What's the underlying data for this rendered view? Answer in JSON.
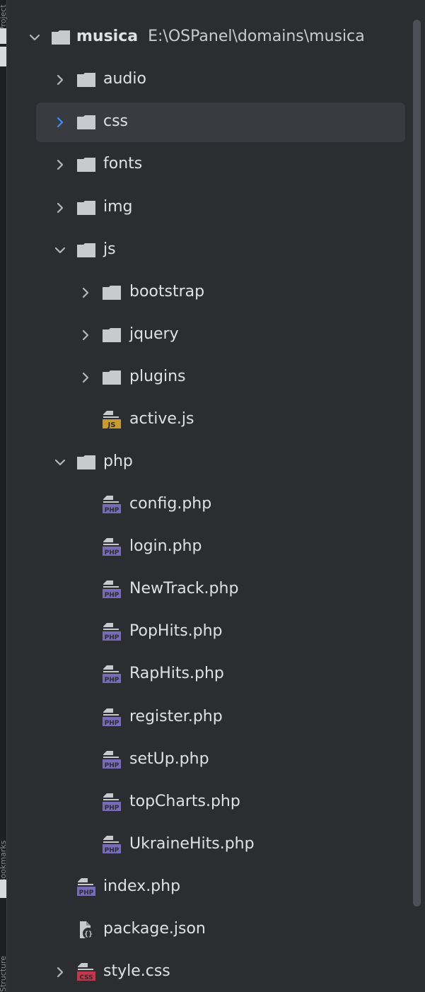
{
  "side_stripe": {
    "top_label": "Project",
    "middle_label": "Bookmarks",
    "bottom_label": "Structure"
  },
  "tree": {
    "root": {
      "name": "musica",
      "path": "E:\\OSPanel\\domains\\musica"
    },
    "items": [
      {
        "name": "audio",
        "kind": "folder"
      },
      {
        "name": "css",
        "kind": "folder",
        "selected": true
      },
      {
        "name": "fonts",
        "kind": "folder"
      },
      {
        "name": "img",
        "kind": "folder"
      },
      {
        "name": "js",
        "kind": "folder",
        "expanded": true
      },
      {
        "name": "bootstrap",
        "kind": "folder"
      },
      {
        "name": "jquery",
        "kind": "folder"
      },
      {
        "name": "plugins",
        "kind": "folder"
      },
      {
        "name": "active.js",
        "kind": "js-file"
      },
      {
        "name": "php",
        "kind": "folder",
        "expanded": true
      },
      {
        "name": "config.php",
        "kind": "php-file"
      },
      {
        "name": "login.php",
        "kind": "php-file"
      },
      {
        "name": "NewTrack.php",
        "kind": "php-file"
      },
      {
        "name": "PopHits.php",
        "kind": "php-file"
      },
      {
        "name": "RapHits.php",
        "kind": "php-file"
      },
      {
        "name": "register.php",
        "kind": "php-file"
      },
      {
        "name": "setUp.php",
        "kind": "php-file"
      },
      {
        "name": "topCharts.php",
        "kind": "php-file"
      },
      {
        "name": "UkraineHits.php",
        "kind": "php-file"
      },
      {
        "name": "index.php",
        "kind": "php-file"
      },
      {
        "name": "package.json",
        "kind": "json-file"
      },
      {
        "name": "style.css",
        "kind": "css-file"
      }
    ],
    "badges": {
      "js": "JS",
      "php": "PHP",
      "css": "CSS"
    }
  },
  "colors": {
    "background": "#2b2d30",
    "selection": "#393b40",
    "accent": "#3d8ef5",
    "folder": "#c8cacd",
    "php_badge": "#7a6bb8",
    "js_badge": "#c99a2e",
    "css_badge": "#c0394b"
  }
}
